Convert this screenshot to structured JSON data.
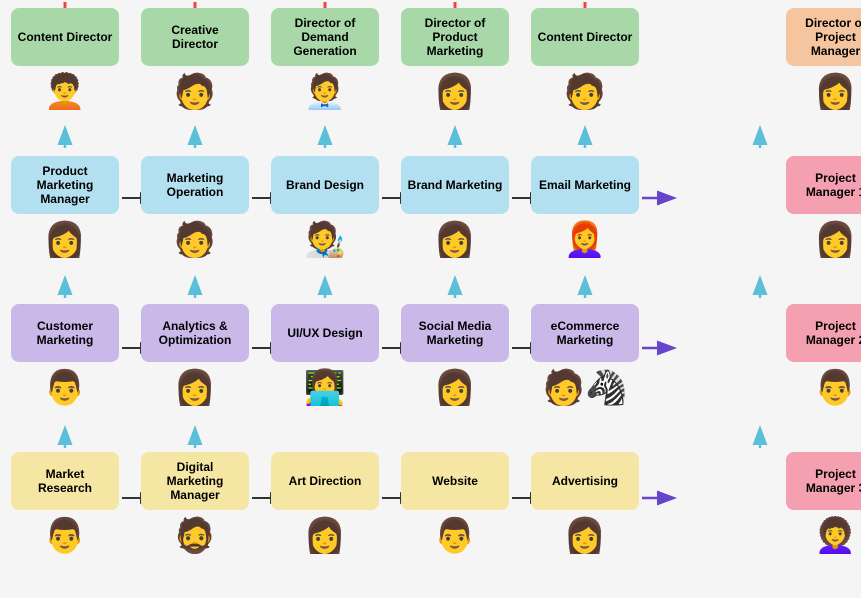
{
  "rows": [
    {
      "id": "row0",
      "cells": [
        {
          "id": "r0c0",
          "label": "Content Director",
          "color": "green",
          "avatar": "👩",
          "hasUpArrow": false,
          "hasRightArrow": false
        },
        {
          "id": "r0c1",
          "label": "Creative Director",
          "color": "green",
          "avatar": "👨",
          "hasUpArrow": false,
          "hasRightArrow": false
        },
        {
          "id": "r0c2",
          "label": "Director of Demand Generation",
          "color": "green",
          "avatar": "👨‍💼",
          "hasUpArrow": false,
          "hasRightArrow": false
        },
        {
          "id": "r0c3",
          "label": "Director of Product Marketing",
          "color": "green",
          "avatar": "👩",
          "hasUpArrow": false,
          "hasRightArrow": false
        },
        {
          "id": "r0c4",
          "label": "Content Director",
          "color": "green",
          "avatar": "👨",
          "hasUpArrow": false,
          "hasRightArrow": false
        },
        {
          "id": "r0c5",
          "label": "",
          "color": "",
          "avatar": "",
          "hasUpArrow": false,
          "hasRightArrow": false
        },
        {
          "id": "r0c6",
          "label": "Director of Project Manager",
          "color": "orange",
          "avatar": "👩",
          "hasUpArrow": false,
          "hasRightArrow": false
        }
      ]
    },
    {
      "id": "row1",
      "cells": [
        {
          "id": "r1c0",
          "label": "Product Marketing Manager",
          "color": "light-blue",
          "avatar": "👩",
          "hasUpArrow": true,
          "hasRightArrow": true
        },
        {
          "id": "r1c1",
          "label": "Marketing Operation",
          "color": "light-blue",
          "avatar": "👨",
          "hasUpArrow": true,
          "hasRightArrow": true
        },
        {
          "id": "r1c2",
          "label": "Brand Design",
          "color": "light-blue",
          "avatar": "👨‍🎨",
          "hasUpArrow": true,
          "hasRightArrow": true
        },
        {
          "id": "r1c3",
          "label": "Brand Marketing",
          "color": "light-blue",
          "avatar": "👩",
          "hasUpArrow": true,
          "hasRightArrow": true
        },
        {
          "id": "r1c4",
          "label": "Email Marketing",
          "color": "light-blue",
          "avatar": "👩",
          "hasUpArrow": true,
          "hasRightArrow": true
        },
        {
          "id": "r1c5",
          "label": "",
          "color": "",
          "avatar": "",
          "hasUpArrow": false,
          "hasRightArrow": false
        },
        {
          "id": "r1c6",
          "label": "Project Manager 1",
          "color": "pink",
          "avatar": "👩",
          "hasUpArrow": true,
          "hasRightArrow": false
        }
      ]
    },
    {
      "id": "row2",
      "cells": [
        {
          "id": "r2c0",
          "label": "Customer Marketing",
          "color": "lavender",
          "avatar": "👨",
          "hasUpArrow": true,
          "hasRightArrow": true
        },
        {
          "id": "r2c1",
          "label": "Analytics & Optimization",
          "color": "lavender",
          "avatar": "👩",
          "hasUpArrow": true,
          "hasRightArrow": true
        },
        {
          "id": "r2c2",
          "label": "UI/UX Design",
          "color": "lavender",
          "avatar": "👩",
          "hasUpArrow": true,
          "hasRightArrow": true
        },
        {
          "id": "r2c3",
          "label": "Social Media Marketing",
          "color": "lavender",
          "avatar": "👩",
          "hasUpArrow": true,
          "hasRightArrow": true
        },
        {
          "id": "r2c4",
          "label": "eCommerce Marketing",
          "color": "lavender",
          "avatar": "👨",
          "hasUpArrow": true,
          "hasRightArrow": true
        },
        {
          "id": "r2c5",
          "label": "",
          "color": "",
          "avatar": "",
          "hasUpArrow": false,
          "hasRightArrow": false
        },
        {
          "id": "r2c6",
          "label": "Project Manager 2",
          "color": "pink",
          "avatar": "👨",
          "hasUpArrow": true,
          "hasRightArrow": false
        }
      ]
    },
    {
      "id": "row3",
      "cells": [
        {
          "id": "r3c0",
          "label": "Market Research",
          "color": "yellow",
          "avatar": "👨",
          "hasUpArrow": true,
          "hasRightArrow": true
        },
        {
          "id": "r3c1",
          "label": "Digital Marketing Manager",
          "color": "yellow",
          "avatar": "👨",
          "hasUpArrow": true,
          "hasRightArrow": true
        },
        {
          "id": "r3c2",
          "label": "Art Direction",
          "color": "yellow",
          "avatar": "👩",
          "hasUpArrow": false,
          "hasRightArrow": true
        },
        {
          "id": "r3c3",
          "label": "Website",
          "color": "yellow",
          "avatar": "👨",
          "hasUpArrow": false,
          "hasRightArrow": true
        },
        {
          "id": "r3c4",
          "label": "Advertising",
          "color": "yellow",
          "avatar": "👩",
          "hasUpArrow": false,
          "hasRightArrow": true
        },
        {
          "id": "r3c5",
          "label": "",
          "color": "",
          "avatar": "",
          "hasUpArrow": false,
          "hasRightArrow": false
        },
        {
          "id": "r3c6",
          "label": "Project Manager 3",
          "color": "pink",
          "avatar": "👩‍🦱",
          "hasUpArrow": true,
          "hasRightArrow": false
        }
      ]
    }
  ],
  "colors": {
    "green": "#a8d8a8",
    "light-blue": "#b3e0f0",
    "lavender": "#c9b8e8",
    "yellow": "#f5e6a3",
    "pink": "#f4a0b0",
    "orange": "#f5c5a0"
  }
}
